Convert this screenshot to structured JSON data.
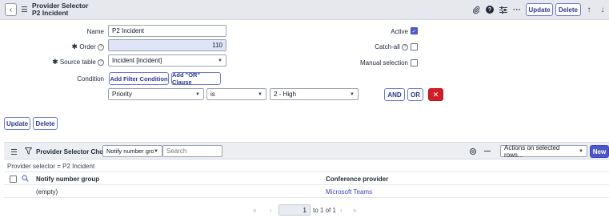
{
  "header": {
    "title": "Provider Selector",
    "subtitle": "P2 Incident",
    "update_label": "Update",
    "delete_label": "Delete"
  },
  "form": {
    "name_label": "Name",
    "name_value": "P2 Incident",
    "order_label": "Order",
    "order_value": "110",
    "source_table_label": "Source table",
    "source_table_value": "Incident [incident]",
    "condition_label": "Condition",
    "add_filter_label": "Add Filter Condition",
    "add_or_label": "Add \"OR\" Clause",
    "cond_field": "Priority",
    "cond_operator": "is",
    "cond_value": "2 - High",
    "and_label": "AND",
    "or_label": "OR",
    "active_label": "Active",
    "active_checked": true,
    "catchall_label": "Catch-all",
    "catchall_checked": false,
    "manual_label": "Manual selection",
    "manual_checked": false,
    "bottom_update_label": "Update",
    "bottom_delete_label": "Delete"
  },
  "related_list": {
    "title": "Provider Selector Choices",
    "search_field_value": "Notify number group",
    "search_placeholder": "Search",
    "actions_value": "Actions on selected rows...",
    "new_label": "New",
    "filter_text": "Provider selector = P2 Incident",
    "columns": [
      "Notify number group",
      "Conference provider"
    ],
    "rows": [
      {
        "notify_number_group": "(empty)",
        "conference_provider": "Microsoft Teams"
      }
    ],
    "pagination": {
      "current": "1",
      "to_text": "to 1 of 1"
    }
  }
}
